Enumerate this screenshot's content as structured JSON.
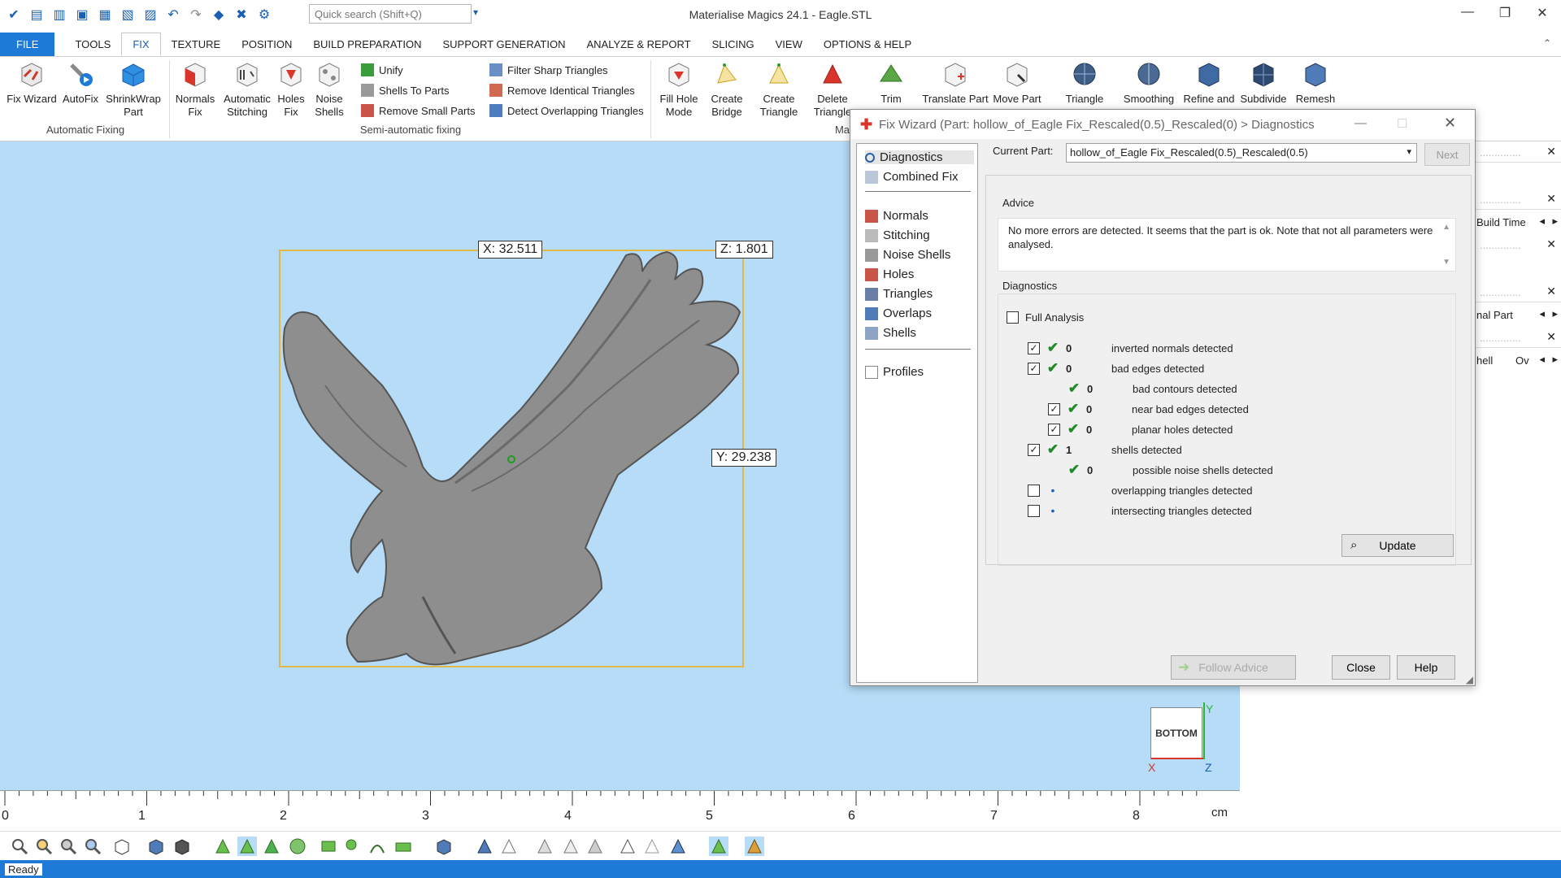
{
  "app": {
    "title": "Materialise Magics 24.1 - Eagle.STL",
    "search_placeholder": "Quick search (Shift+Q)"
  },
  "menu": [
    "FILE",
    "TOOLS",
    "FIX",
    "TEXTURE",
    "POSITION",
    "BUILD PREPARATION",
    "SUPPORT GENERATION",
    "ANALYZE & REPORT",
    "SLICING",
    "VIEW",
    "OPTIONS & HELP"
  ],
  "ribbon": {
    "auto": [
      "Fix Wizard",
      "AutoFix",
      "ShrinkWrap Part"
    ],
    "auto_group": "Automatic Fixing",
    "semi": [
      "Normals Fix",
      "Automatic Stitching",
      "Holes Fix",
      "Noise Shells"
    ],
    "semi_small": [
      "Unify",
      "Shells To Parts",
      "Remove Small Parts"
    ],
    "semi_group": "Semi-automatic fixing",
    "tri_small": [
      "Filter Sharp Triangles",
      "Remove Identical Triangles",
      "Detect Overlapping Triangles"
    ],
    "manual": [
      "Fill Hole Mode",
      "Create Bridge",
      "Create Triangle",
      "Delete Triangle",
      "Trim",
      "Translate Part",
      "Move Part",
      "Triangle",
      "Smoothing",
      "Refine and",
      "Subdivide",
      "Remesh"
    ],
    "manual_group": "Ma"
  },
  "viewport": {
    "x_label": "X: 32.511",
    "y_label": "Y: 29.238",
    "z_label": "Z: 1.801",
    "view_cube": "BOTTOM",
    "axis_y": "Y",
    "axis_x": "X",
    "axis_z": "Z"
  },
  "ruler": {
    "ticks": [
      "0",
      "1",
      "2",
      "3",
      "4",
      "5",
      "6",
      "7",
      "8"
    ],
    "unit": "cm"
  },
  "right_panels": {
    "build_time": "Build Time",
    "nal_part": "nal Part",
    "hell": "hell",
    "ov": "Ov"
  },
  "status": "Ready",
  "dialog": {
    "title": "Fix Wizard (Part: hollow_of_Eagle Fix_Rescaled(0.5)_Rescaled(0) > Diagnostics",
    "tree_top": [
      "Diagnostics",
      "Combined Fix"
    ],
    "tree_mid": [
      "Normals",
      "Stitching",
      "Noise Shells",
      "Holes",
      "Triangles",
      "Overlaps",
      "Shells"
    ],
    "tree_bottom": [
      "Profiles"
    ],
    "current_part_label": "Current Part:",
    "current_part_value": "hollow_of_Eagle Fix_Rescaled(0.5)_Rescaled(0.5)",
    "next": "Next",
    "advice_label": "Advice",
    "advice_text": "No more errors are detected. It seems that the part is ok. Note that not all parameters were analysed.",
    "diagnostics_label": "Diagnostics",
    "full_analysis": "Full Analysis",
    "rows": [
      {
        "count": "0",
        "label": "inverted normals detected"
      },
      {
        "count": "0",
        "label": "bad edges detected"
      },
      {
        "count": "0",
        "label": "bad contours detected"
      },
      {
        "count": "0",
        "label": "near bad edges detected"
      },
      {
        "count": "0",
        "label": "planar holes detected"
      },
      {
        "count": "1",
        "label": "shells detected"
      },
      {
        "count": "0",
        "label": "possible noise shells detected"
      },
      {
        "count": "",
        "label": "overlapping triangles detected"
      },
      {
        "count": "",
        "label": "intersecting triangles detected"
      }
    ],
    "update": "Update",
    "follow_advice": "Follow Advice",
    "close": "Close",
    "help": "Help"
  }
}
